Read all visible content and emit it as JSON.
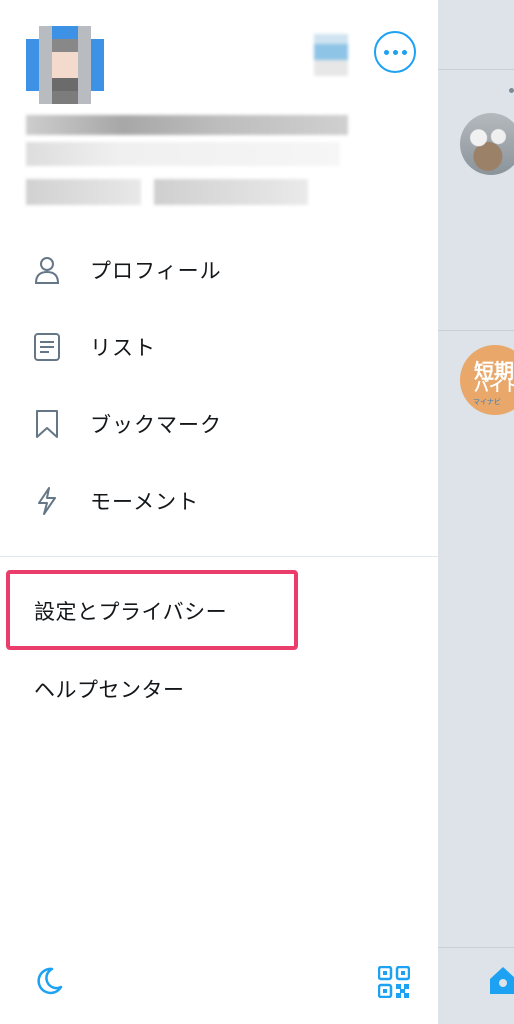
{
  "menu": {
    "items": [
      {
        "label": "プロフィール",
        "icon": "person-icon"
      },
      {
        "label": "リスト",
        "icon": "list-icon"
      },
      {
        "label": "ブックマーク",
        "icon": "bookmark-icon"
      },
      {
        "label": "モーメント",
        "icon": "lightning-icon"
      }
    ]
  },
  "settings": {
    "settings_privacy_label": "設定とプライバシー",
    "help_center_label": "ヘルプセンター"
  },
  "background_timeline": {
    "ad_text_line1": "短期",
    "ad_text_line2": "バイト",
    "ad_caption": "マイナビ"
  },
  "colors": {
    "accent": "#1da1f2",
    "highlight": "#ea3d6c",
    "overlay": "#dde3e8",
    "text": "#14171a"
  }
}
